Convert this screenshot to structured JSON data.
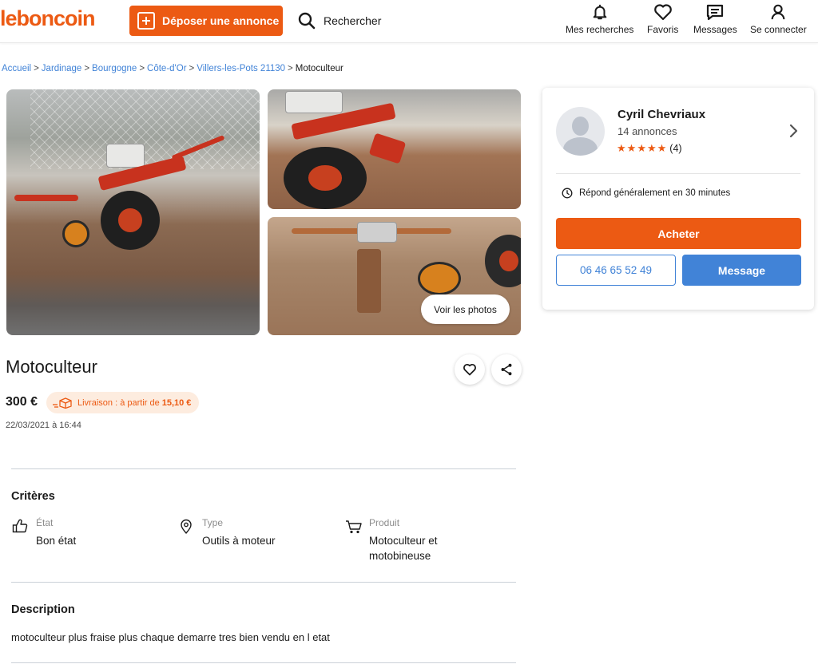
{
  "header": {
    "logo": "leboncoin",
    "deposit_label": "Déposer une annonce",
    "search_label": "Rechercher",
    "nav": [
      {
        "label": "Mes recherches",
        "icon": "bell-icon"
      },
      {
        "label": "Favoris",
        "icon": "heart-icon"
      },
      {
        "label": "Messages",
        "icon": "message-icon"
      },
      {
        "label": "Se connecter",
        "icon": "user-icon"
      }
    ]
  },
  "breadcrumb": {
    "items": [
      "Accueil",
      "Jardinage",
      "Bourgogne",
      "Côte-d'Or",
      "Villers-les-Pots 21130"
    ],
    "separator": ">",
    "current": "Motoculteur"
  },
  "gallery": {
    "see_photos_label": "Voir les photos"
  },
  "ad": {
    "title": "Motoculteur",
    "price": "300 €",
    "delivery_prefix": "Livraison : à partir de",
    "delivery_price": "15,10 €",
    "date": "22/03/2021 à 16:44"
  },
  "criteria": {
    "title": "Critères",
    "items": [
      {
        "label": "État",
        "value": "Bon état",
        "icon": "thumbs-up-icon"
      },
      {
        "label": "Type",
        "value": "Outils à moteur",
        "icon": "location-pin-icon"
      },
      {
        "label": "Produit",
        "value": "Motoculteur et motobineuse",
        "icon": "cart-icon"
      }
    ]
  },
  "description": {
    "title": "Description",
    "text": "motoculteur plus fraise plus chaque demarre tres bien vendu en l etat"
  },
  "seller": {
    "name": "Cyril Chevriaux",
    "ads_count": "14 annonces",
    "rating_stars": 5,
    "rating_count": "(4)",
    "response_time": "Répond généralement en 30 minutes",
    "buy_label": "Acheter",
    "phone": "06 46 65 52 49",
    "message_label": "Message"
  },
  "colors": {
    "brand_orange": "#ec5a13",
    "link_blue": "#4183d7",
    "delivery_bg": "#fdecdf"
  }
}
